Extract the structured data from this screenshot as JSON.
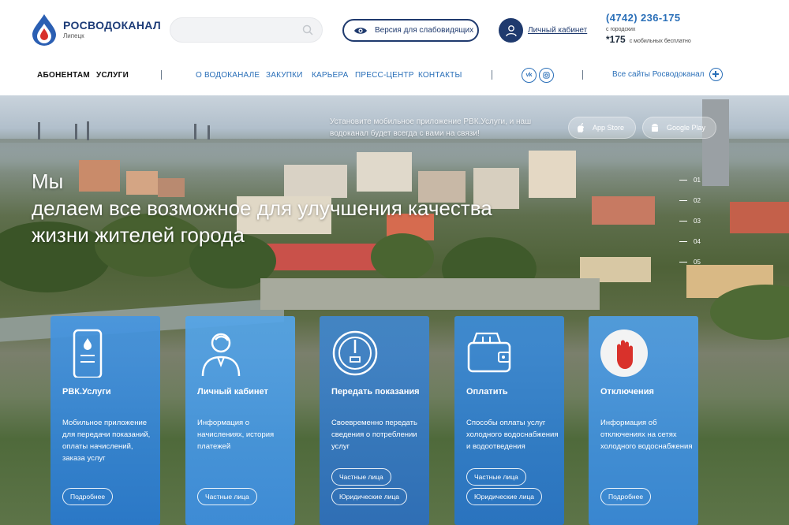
{
  "brand": {
    "name": "РОСВОДОКАНАЛ",
    "city": "Липецк"
  },
  "search": {
    "placeholder": "",
    "value": ""
  },
  "accessibility": {
    "label": "Версия для слабовидящих"
  },
  "cabinet": {
    "label": "Личный кабинет"
  },
  "contacts": {
    "phone": "(4742) 236-175",
    "phone_note": "с городских",
    "short_number": "*175",
    "short_note": "с мобильных бесплатно"
  },
  "nav": {
    "main": [
      "АБОНЕНТАМ",
      "УСЛУГИ"
    ],
    "secondary": [
      "О ВОДОКАНАЛЕ",
      "ЗАКУПКИ",
      "КАРЬЕРА",
      "ПРЕСС-ЦЕНТР",
      "КОНТАКТЫ"
    ],
    "social": [
      "vk-icon",
      "instagram-icon"
    ],
    "all_sites": "Все сайты Росводоканал"
  },
  "hero": {
    "headline": [
      "Мы",
      "делаем все возможное для улучшения качества",
      "жизни жителей города"
    ],
    "app_promo": "Установите мобильное приложение РВК.Услуги, и наш водоканал будет всегда с вами на связи!",
    "app_store": "App Store",
    "google_play": "Google Play",
    "slides": [
      "01",
      "02",
      "03",
      "04",
      "05"
    ]
  },
  "cards": [
    {
      "title": "РВК.Услуги",
      "desc": "Мобильное приложение для передачи показаний, оплаты начислений, заказа услуг",
      "buttons": [
        "Подробнее"
      ],
      "icon": "mobile-app-icon",
      "color": "#3b8ed8"
    },
    {
      "title": "Личный кабинет",
      "desc": "Информация о начислениях, история платежей",
      "buttons": [
        "Частные лица"
      ],
      "icon": "user-icon",
      "color": "#4a9be0"
    },
    {
      "title": "Передать показания",
      "desc": "Своевременно передать сведения о потреблении услуг",
      "buttons": [
        "Частные лица",
        "Юридические лица"
      ],
      "icon": "meter-icon",
      "color": "#3e7fc4"
    },
    {
      "title": "Оплатить",
      "desc": "Способы оплаты услуг холодного водоснабжения и водоотведения",
      "buttons": [
        "Частные лица",
        "Юридические лица"
      ],
      "icon": "wallet-icon",
      "color": "#3a86d0"
    },
    {
      "title": "Отключения",
      "desc": "Информация об отключениях на сетях холодного водоснабжения",
      "buttons": [
        "Подробнее"
      ],
      "icon": "stop-hand-icon",
      "color": "#4a98dc"
    }
  ],
  "colors": {
    "brand_dark": "#1f3a6e",
    "link_blue": "#2a6fb8",
    "alert_red": "#d9312b"
  }
}
